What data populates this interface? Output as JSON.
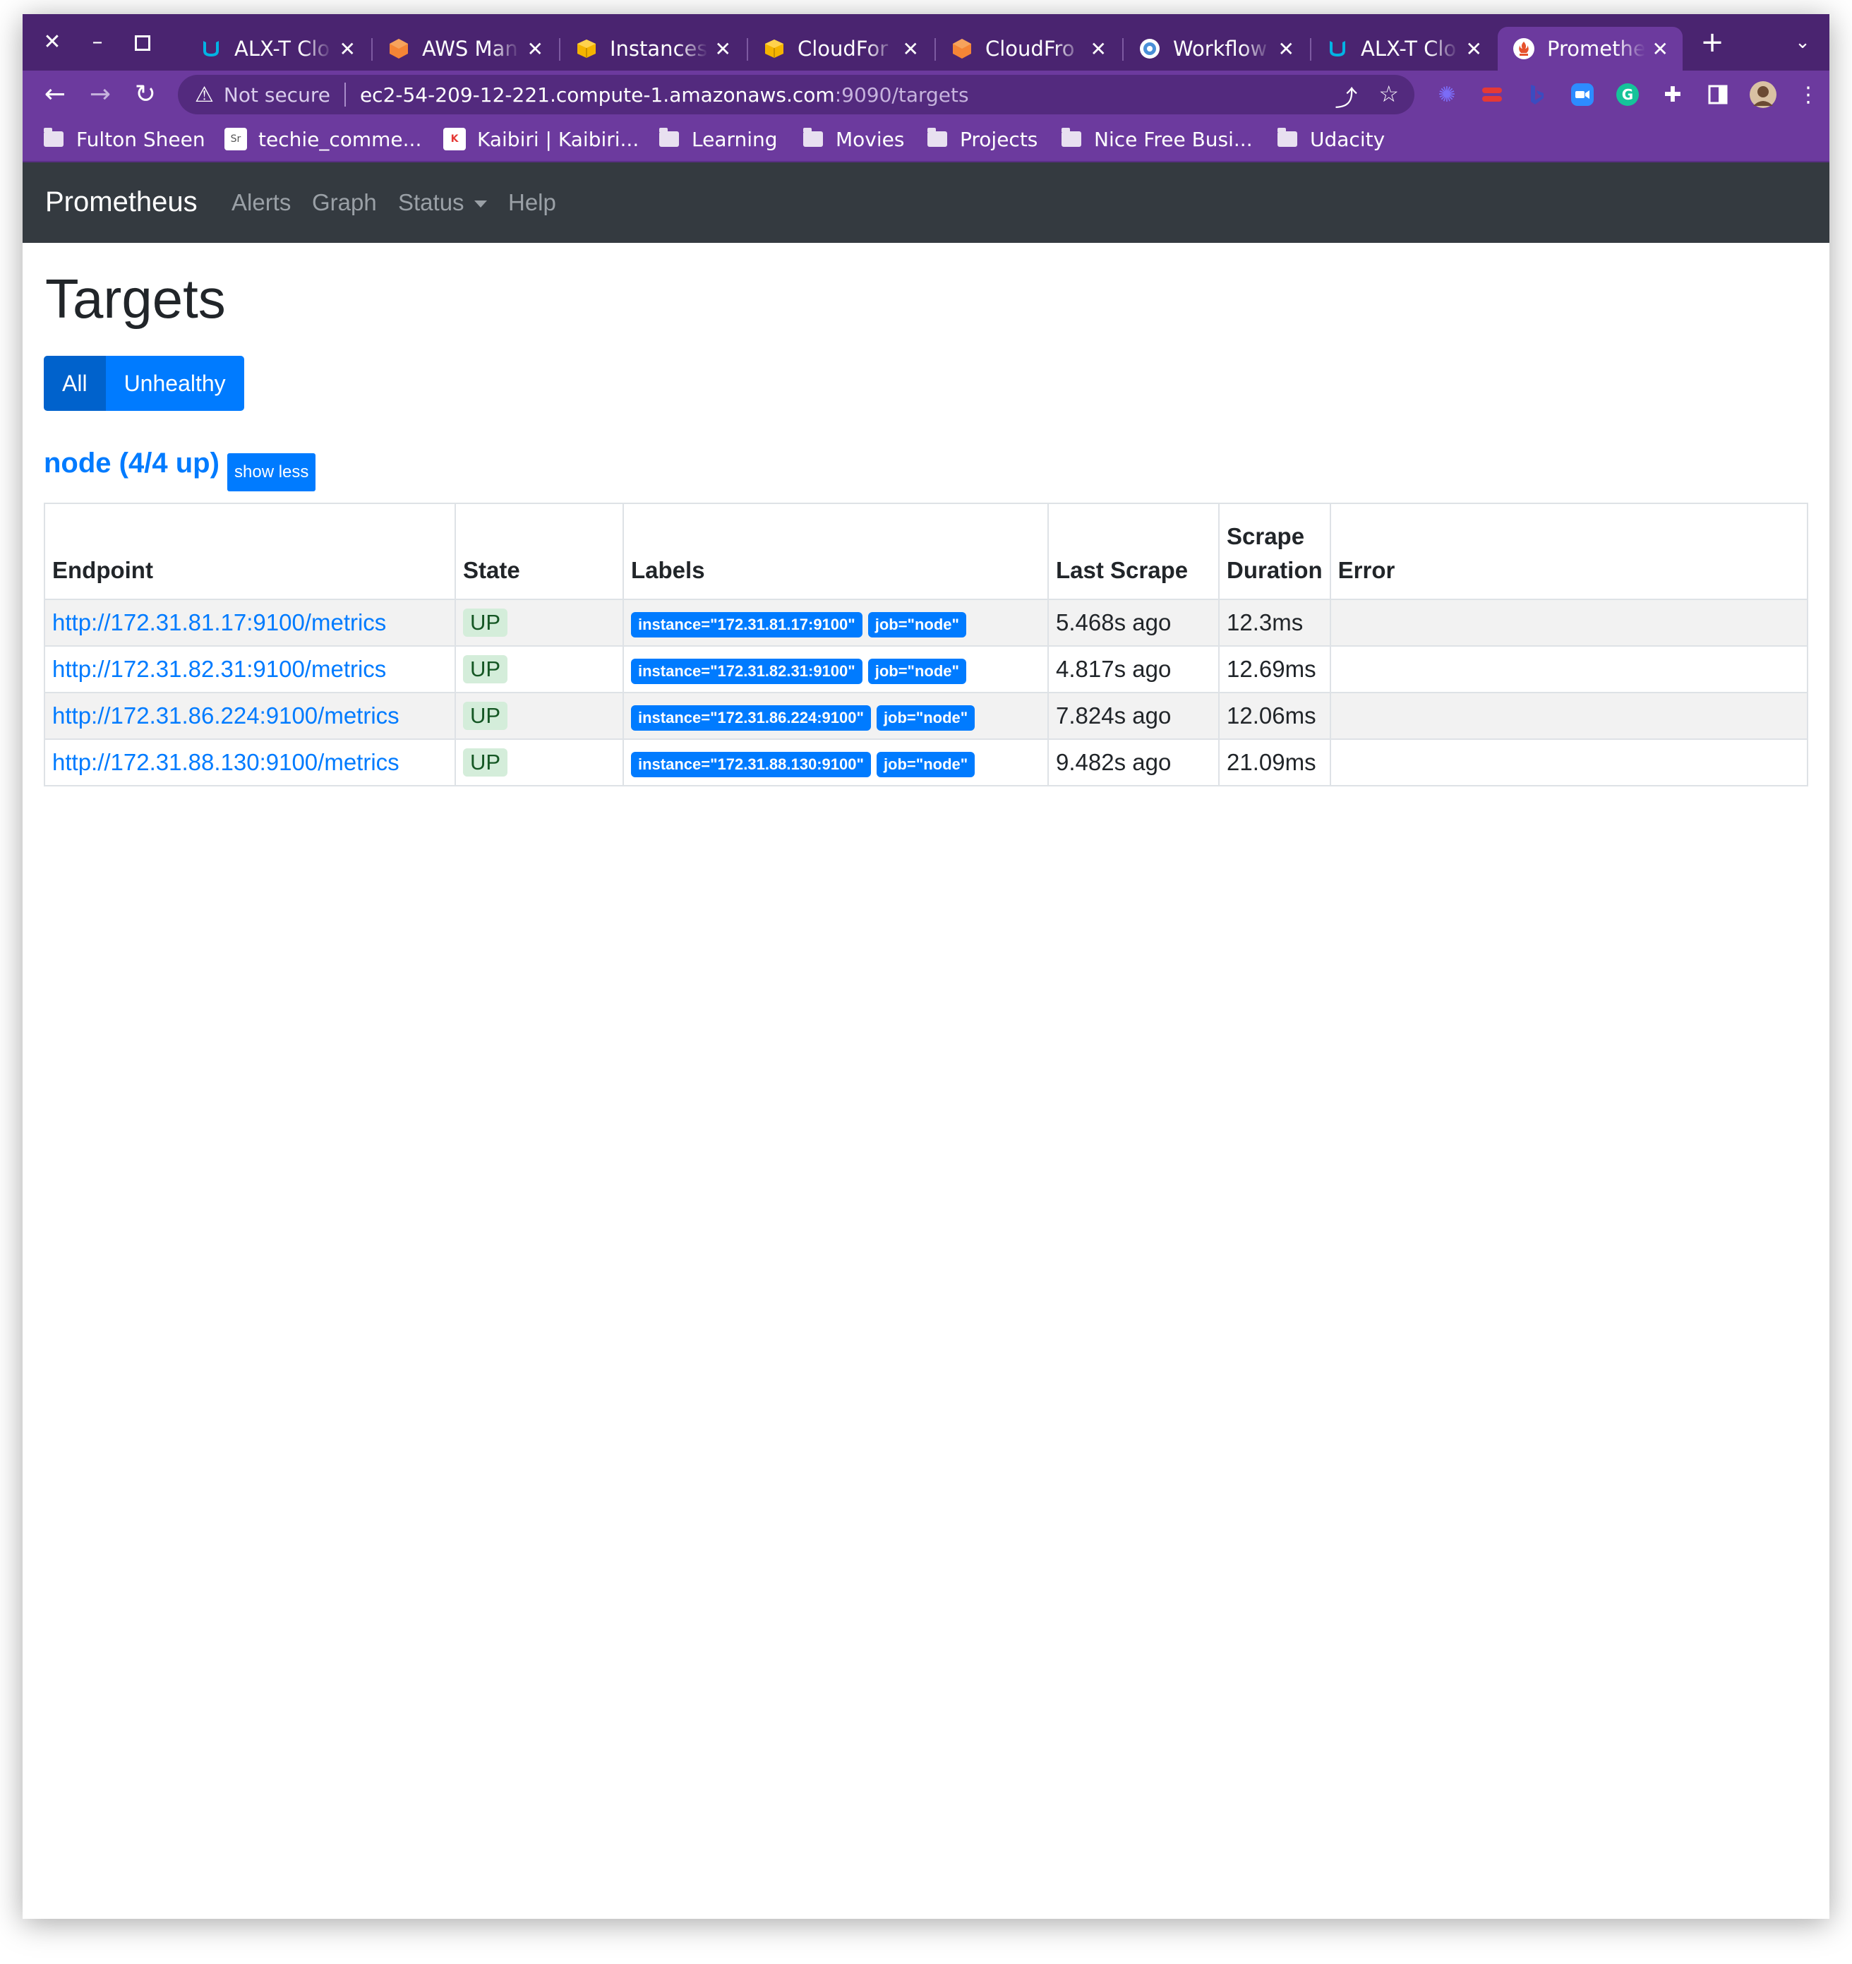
{
  "browser": {
    "tabs": [
      {
        "title": "ALX-T Clo",
        "icon": "udacity-icon",
        "active": false
      },
      {
        "title": "AWS Man",
        "icon": "aws-icon",
        "active": false
      },
      {
        "title": "Instances",
        "icon": "ec2-box-icon",
        "active": false
      },
      {
        "title": "CloudFor",
        "icon": "cloudformation-box-icon",
        "active": false
      },
      {
        "title": "CloudFro",
        "icon": "aws-icon",
        "active": false
      },
      {
        "title": "Workflow",
        "icon": "circleci-icon",
        "active": false
      },
      {
        "title": "ALX-T Clo",
        "icon": "udacity-icon",
        "active": false
      },
      {
        "title": "Promethe",
        "icon": "prometheus-icon",
        "active": true
      }
    ],
    "address": {
      "security": "Not secure",
      "host": "ec2-54-209-12-221.compute-1.amazonaws.com",
      "path": ":9090/targets"
    },
    "bookmarks": [
      {
        "label": "Fulton Sheen",
        "icon": "folder-icon"
      },
      {
        "label": "techie_comme...",
        "icon": "site-icon"
      },
      {
        "label": "Kaibiri | Kaibiri...",
        "icon": "site-icon"
      },
      {
        "label": "Learning",
        "icon": "folder-icon"
      },
      {
        "label": "Movies",
        "icon": "folder-icon"
      },
      {
        "label": "Projects",
        "icon": "folder-icon"
      },
      {
        "label": "Nice Free Busi...",
        "icon": "folder-icon"
      },
      {
        "label": "Udacity",
        "icon": "folder-icon"
      }
    ]
  },
  "app": {
    "brand": "Prometheus",
    "nav": {
      "alerts": "Alerts",
      "graph": "Graph",
      "status": "Status",
      "help": "Help"
    }
  },
  "page": {
    "title": "Targets",
    "filters": {
      "all": "All",
      "unhealthy": "Unhealthy"
    },
    "group": {
      "title": "node (4/4 up)",
      "toggle": "show less"
    },
    "table": {
      "headers": {
        "endpoint": "Endpoint",
        "state": "State",
        "labels": "Labels",
        "last_scrape": "Last Scrape",
        "scrape_duration_1": "Scrape",
        "scrape_duration_2": "Duration",
        "error": "Error"
      },
      "rows": [
        {
          "endpoint": "http://172.31.81.17:9100/metrics",
          "state": "UP",
          "instance": "instance=\"172.31.81.17:9100\"",
          "job": "job=\"node\"",
          "last_scrape": "5.468s ago",
          "duration": "12.3ms",
          "error": ""
        },
        {
          "endpoint": "http://172.31.82.31:9100/metrics",
          "state": "UP",
          "instance": "instance=\"172.31.82.31:9100\"",
          "job": "job=\"node\"",
          "last_scrape": "4.817s ago",
          "duration": "12.69ms",
          "error": ""
        },
        {
          "endpoint": "http://172.31.86.224:9100/metrics",
          "state": "UP",
          "instance": "instance=\"172.31.86.224:9100\"",
          "job": "job=\"node\"",
          "last_scrape": "7.824s ago",
          "duration": "12.06ms",
          "error": ""
        },
        {
          "endpoint": "http://172.31.88.130:9100/metrics",
          "state": "UP",
          "instance": "instance=\"172.31.88.130:9100\"",
          "job": "job=\"node\"",
          "last_scrape": "9.482s ago",
          "duration": "21.09ms",
          "error": ""
        }
      ]
    }
  },
  "colors": {
    "browser_frame": "#6c3a9e",
    "navbar": "#343a40",
    "primary": "#007bff",
    "state_up_bg": "#d4edda"
  }
}
